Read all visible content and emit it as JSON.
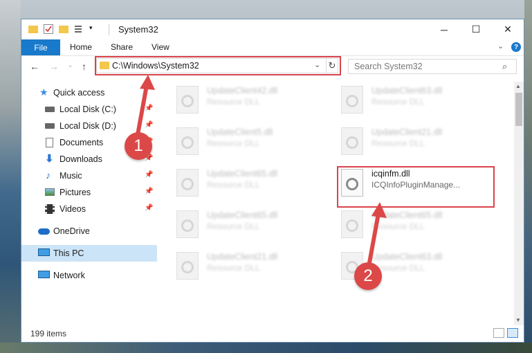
{
  "window": {
    "title": "System32",
    "buttons": {
      "minimize": "─",
      "maximize": "☐",
      "close": "✕"
    }
  },
  "ribbon": {
    "tabs": [
      "File",
      "Home",
      "Share",
      "View"
    ],
    "collapse_glyph": "⌄",
    "help_glyph": "?"
  },
  "navigation": {
    "back": "←",
    "forward": "→",
    "recent": "⌄",
    "up": "↑",
    "address": "C:\\Windows\\System32",
    "address_dropdown": "⌄",
    "refresh": "↻"
  },
  "search": {
    "placeholder": "Search System32",
    "icon": "⌕"
  },
  "sidebar": {
    "items": [
      {
        "label": "Quick access",
        "icon": "star-icon",
        "pinned": false
      },
      {
        "label": "Local Disk (C:)",
        "icon": "drive-icon",
        "pinned": true
      },
      {
        "label": "Local Disk (D:)",
        "icon": "drive-icon",
        "pinned": true
      },
      {
        "label": "Documents",
        "icon": "document-icon",
        "pinned": true
      },
      {
        "label": "Downloads",
        "icon": "download-icon",
        "pinned": true
      },
      {
        "label": "Music",
        "icon": "music-icon",
        "pinned": true
      },
      {
        "label": "Pictures",
        "icon": "picture-icon",
        "pinned": true
      },
      {
        "label": "Videos",
        "icon": "video-icon",
        "pinned": true
      },
      {
        "label": "OneDrive",
        "icon": "cloud-icon",
        "pinned": false
      },
      {
        "label": "This PC",
        "icon": "computer-icon",
        "pinned": false,
        "selected": true
      },
      {
        "label": "Network",
        "icon": "network-icon",
        "pinned": false
      }
    ],
    "pin_glyph": "📌"
  },
  "files": [
    {
      "name": "UpdateClient42.dll",
      "type": "Resource DLL"
    },
    {
      "name": "UpdateClient63.dll",
      "type": "Resource DLL"
    },
    {
      "name": "UpdateClient5.dll",
      "type": "Resource DLL"
    },
    {
      "name": "UpdateClient21.dll",
      "type": "Resource DLL"
    },
    {
      "name": "UpdateClient65.dll",
      "type": "Resource DLL"
    },
    {
      "name": "icqinfm.dll",
      "type": "ICQInfoPluginManage...",
      "highlighted": true
    },
    {
      "name": "UpdateClient65.dll",
      "type": "Resource DLL"
    },
    {
      "name": "UpdateClient65.dll",
      "type": "Resource DLL"
    },
    {
      "name": "UpdateClient21.dll",
      "type": "Resource DLL"
    },
    {
      "name": "UpdateClient63.dll",
      "type": "Resource DLL"
    }
  ],
  "status": {
    "item_count": "199 items"
  },
  "callouts": {
    "step1": "1",
    "step2": "2"
  },
  "colors": {
    "accent": "#1979ca",
    "highlight_border": "#d9434a",
    "callout": "#dc4848",
    "selected_nav": "#cce4f7"
  }
}
